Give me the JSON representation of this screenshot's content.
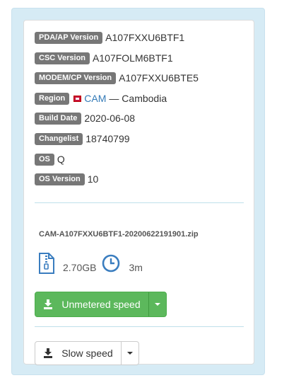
{
  "firmware": {
    "pda_label": "PDA/AP Version",
    "pda_value": "A107FXXU6BTF1",
    "csc_label": "CSC Version",
    "csc_value": "A107FOLM6BTF1",
    "modem_label": "MODEM/CP Version",
    "modem_value": "A107FXXU6BTE5",
    "region_label": "Region",
    "region_code": "CAM",
    "region_name": "— Cambodia",
    "build_label": "Build Date",
    "build_value": "2020-06-08",
    "changelist_label": "Changelist",
    "changelist_value": "18740799",
    "os_label": "OS",
    "os_value": "Q",
    "osver_label": "OS Version",
    "osver_value": "10"
  },
  "download": {
    "filename": "CAM-A107FXXU6BTF1-20200622191901.zip",
    "size": "2.70GB",
    "time": "3m",
    "fast_label": "Unmetered speed",
    "slow_label": "Slow speed"
  },
  "colors": {
    "label_bg": "#777777",
    "green": "#5cb85c",
    "panel_bg": "#d6ebf5",
    "link": "#337ab7",
    "icon_blue": "#3a7dbf"
  },
  "icons": [
    "zip-file-icon",
    "clock-icon",
    "download-icon",
    "caret-down-icon",
    "flag-icon"
  ]
}
